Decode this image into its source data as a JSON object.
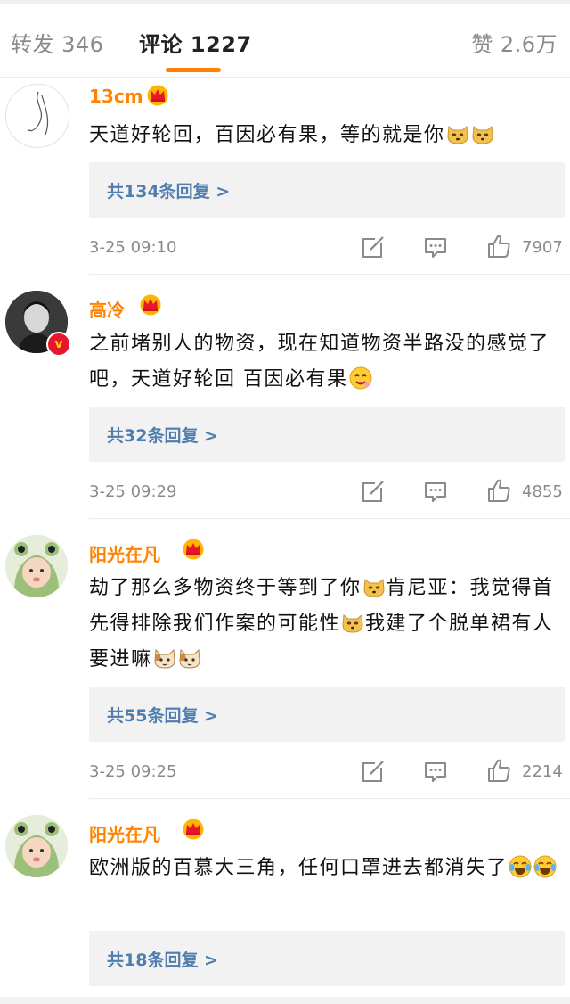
{
  "tabs": {
    "reposts": "转发 346",
    "comments": "评论 1227",
    "likes": "赞 2.6万"
  },
  "colors": {
    "accent": "#ff8200",
    "link": "#507daf",
    "meta": "#8a8a8a"
  },
  "comments": [
    {
      "username": "13cm",
      "text": "天道好轮回，百因必有果，等的就是你",
      "emojis": [
        "doge-emoji",
        "doge-emoji"
      ],
      "replies": "共134条回复 >",
      "time": "3-25 09:10",
      "likes": "7907"
    },
    {
      "username": "高冷",
      "text": "之前堵别人的物资，现在知道物资半路没的感觉了吧，天道好轮回 百因必有果",
      "emojis": [
        "drool-emoji"
      ],
      "verified": true,
      "replies": "共32条回复 >",
      "time": "3-25 09:29",
      "likes": "4855"
    },
    {
      "username": "阳光在凡",
      "text_a": "劫了那么多物资终于等到了你",
      "text_b": "肯尼亚：我觉得首先得排除我们作案的可能性",
      "text_c": "我建了个脱单裙有人要进嘛",
      "emojis": [
        "doge-emoji",
        "doge-emoji",
        "cat-emoji",
        "cat-emoji"
      ],
      "replies": "共55条回复 >",
      "time": "3-25 09:25",
      "likes": "2214"
    },
    {
      "username": "阳光在凡",
      "text": "欧洲版的百慕大三角，任何口罩进去都消失了",
      "emojis": [
        "laugh-cry-emoji",
        "laugh-cry-emoji"
      ],
      "replies": "共18条回复 >"
    }
  ]
}
